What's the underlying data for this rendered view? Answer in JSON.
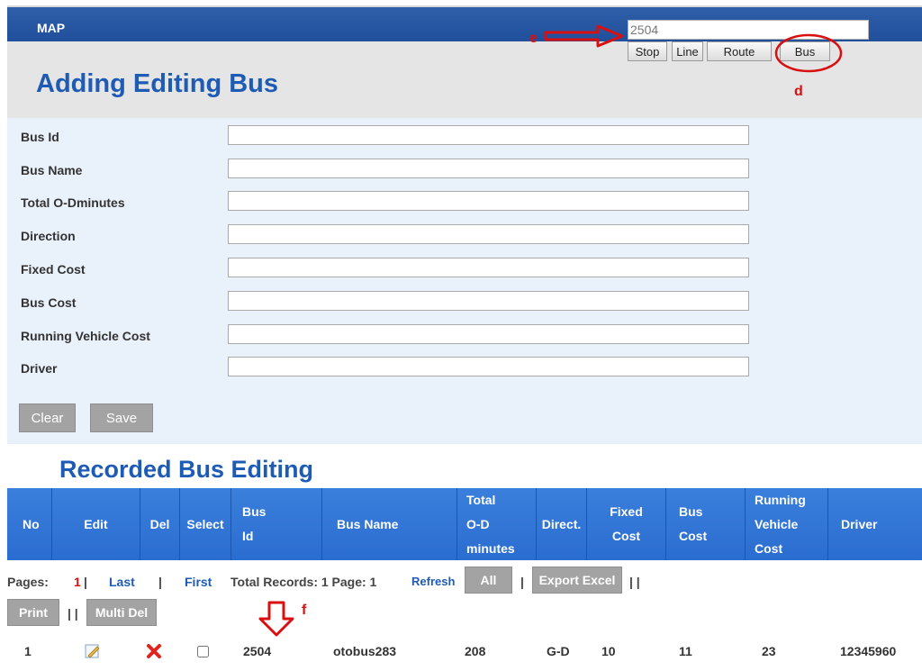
{
  "header": {
    "map_label": "MAP",
    "search_value": "2504",
    "nav_buttons": [
      "Stop",
      "Line",
      "Route",
      "Bus"
    ],
    "page_title": "Adding Editing Bus"
  },
  "annotations": {
    "e": "e",
    "d": "d",
    "f": "f"
  },
  "form": {
    "fields": [
      {
        "label": "Bus Id",
        "value": ""
      },
      {
        "label": "Bus Name",
        "value": ""
      },
      {
        "label": "Total O-Dminutes",
        "value": ""
      },
      {
        "label": "Direction",
        "value": ""
      },
      {
        "label": "Fixed Cost",
        "value": ""
      },
      {
        "label": "Bus Cost",
        "value": ""
      },
      {
        "label": "Running Vehicle Cost",
        "value": ""
      },
      {
        "label": "Driver",
        "value": ""
      }
    ],
    "clear_label": "Clear",
    "save_label": "Save"
  },
  "table": {
    "title": "Recorded Bus Editing",
    "columns": [
      {
        "id": "no",
        "label": "No"
      },
      {
        "id": "edit",
        "label": "Edit"
      },
      {
        "id": "del",
        "label": "Del"
      },
      {
        "id": "select",
        "label": "Select"
      },
      {
        "id": "bus_id",
        "label": "Bus\nId"
      },
      {
        "id": "bus_name",
        "label": "Bus Name"
      },
      {
        "id": "total_od",
        "label": "Total\nO-D\nminutes"
      },
      {
        "id": "direct",
        "label": "Direct."
      },
      {
        "id": "fixed_cost",
        "label": "Fixed\nCost"
      },
      {
        "id": "bus_cost",
        "label": "Bus\nCost"
      },
      {
        "id": "running_cost",
        "label": "Running\nVehicle\nCost"
      },
      {
        "id": "driver",
        "label": "Driver"
      }
    ],
    "rows": [
      {
        "no": "1",
        "bus_id": "2504",
        "bus_name": "otobus283",
        "total_od": "208",
        "direct": "G-D",
        "fixed_cost": "10",
        "bus_cost": "11",
        "running_cost": "23",
        "driver": "12345960"
      }
    ],
    "pager": {
      "pages_label": "Pages:",
      "current_page": "1",
      "sep1": "|",
      "last": "Last",
      "sep2": "|",
      "first": "First",
      "total_records": "Total Records: 1 Page: 1",
      "refresh": "Refresh",
      "all": "All",
      "sep3": "|",
      "export": "Export Excel",
      "sep4": "| |",
      "print": "Print",
      "sep5": "| |",
      "multi_del": "Multi Del"
    }
  },
  "colors": {
    "accent": "#1e5bb5",
    "header_blue": "#2a6dd0",
    "annotation": "#d81010"
  },
  "icons": {
    "edit": "edit-icon",
    "delete": "delete-x-icon",
    "arrow_e": "right-arrow-icon",
    "arrow_f": "down-arrow-icon"
  }
}
